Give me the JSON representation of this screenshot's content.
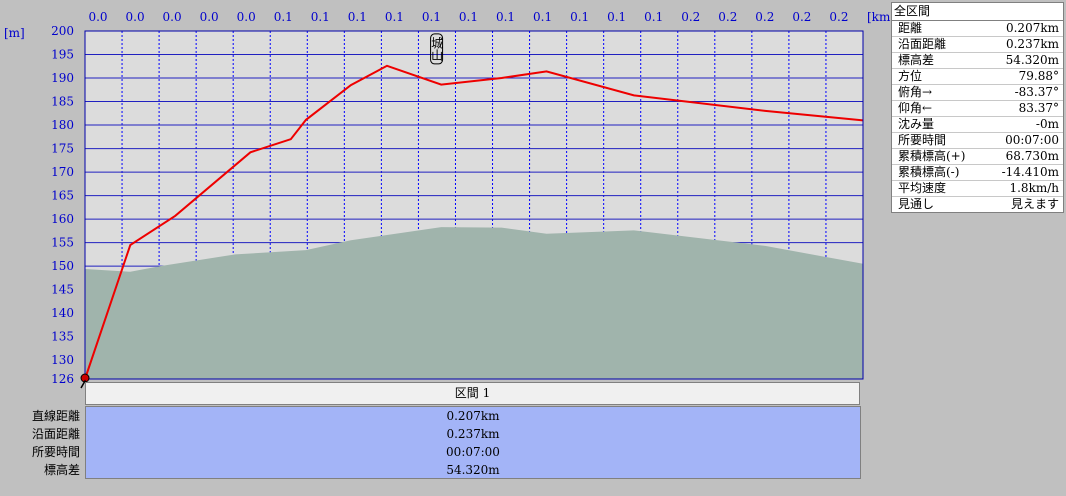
{
  "chart_data": {
    "type": "area",
    "y_unit": "[m]",
    "x_unit": "[km]",
    "ylim": [
      126,
      200
    ],
    "y_ticks": [
      126,
      130,
      135,
      140,
      145,
      150,
      155,
      160,
      165,
      170,
      175,
      180,
      185,
      190,
      195,
      200
    ],
    "x_tick_labels": [
      "0.0",
      "0.0",
      "0.0",
      "0.0",
      "0.0",
      "0.1",
      "0.1",
      "0.1",
      "0.1",
      "0.1",
      "0.1",
      "0.1",
      "0.1",
      "0.1",
      "0.1",
      "0.1",
      "0.2",
      "0.2",
      "0.2",
      "0.2",
      "0.2"
    ],
    "x_range_km": [
      0,
      0.237
    ],
    "profile_color": "#ee0000",
    "terrain_color": "#a0b4ac",
    "grid": true,
    "series": [
      {
        "values_x": [
          0.0,
          0.0138,
          0.0275,
          0.0504,
          0.0627,
          0.0673,
          0.081,
          0.092,
          0.1085,
          0.1269,
          0.1406,
          0.1672,
          0.2072,
          0.237
        ],
        "values_y": [
          126.0,
          154.5,
          160.7,
          174.2,
          177.0,
          181.1,
          188.5,
          192.6,
          188.6,
          190.0,
          191.4,
          186.3,
          183.0,
          181.0
        ]
      },
      {
        "values_x": [
          0.0,
          0.0138,
          0.0229,
          0.0458,
          0.0673,
          0.081,
          0.1085,
          0.1269,
          0.1406,
          0.1672,
          0.2072,
          0.237
        ],
        "values_y": [
          149.4,
          148.8,
          150.0,
          152.5,
          153.4,
          155.5,
          158.3,
          158.2,
          156.9,
          157.6,
          154.3,
          150.5
        ]
      }
    ],
    "annotations": [
      {
        "text": "城山",
        "x": 0.1071,
        "y": 193.0
      }
    ]
  },
  "summary": {
    "title": "全区間",
    "rows": [
      {
        "label": "距離",
        "value": "0.207km"
      },
      {
        "label": "沿面距離",
        "value": "0.237km"
      },
      {
        "label": "標高差",
        "value": "54.320m"
      },
      {
        "label": "方位",
        "value": "79.88°"
      },
      {
        "label": "俯角→",
        "value": "-83.37°"
      },
      {
        "label": "仰角←",
        "value": "83.37°"
      },
      {
        "label": "沈み量",
        "value": "-0m"
      },
      {
        "label": "所要時間",
        "value": "00:07:00"
      },
      {
        "label": "累積標高(+)",
        "value": "68.730m"
      },
      {
        "label": "累積標高(-)",
        "value": "-14.410m"
      },
      {
        "label": "平均速度",
        "value": "1.8km/h"
      },
      {
        "label": "見通し",
        "value": "見えます"
      }
    ]
  },
  "section": {
    "header": "区間 1",
    "labels": [
      "直線距離",
      "沿面距離",
      "所要時間",
      "標高差"
    ],
    "values": [
      "0.207km",
      "0.237km",
      "00:07:00",
      "54.320m"
    ]
  }
}
